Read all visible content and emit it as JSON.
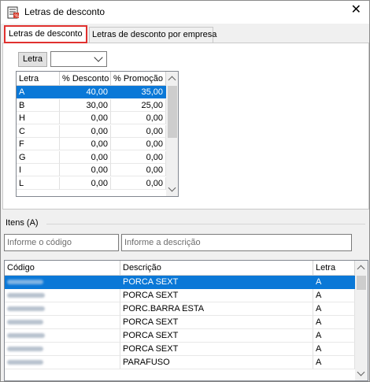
{
  "window": {
    "title": "Letras de desconto",
    "close_glyph": "✕"
  },
  "tabs": [
    {
      "label": "Letras de desconto",
      "active": true
    },
    {
      "label": "Letras de desconto por empresa",
      "active": false
    }
  ],
  "letra_filter": {
    "button_label": "Letra",
    "combo_value": ""
  },
  "letras_grid": {
    "columns": [
      "Letra",
      "% Desconto",
      "% Promoção"
    ],
    "rows": [
      {
        "letra": "A",
        "desconto": "40,00",
        "promocao": "35,00",
        "selected": true
      },
      {
        "letra": "B",
        "desconto": "30,00",
        "promocao": "25,00"
      },
      {
        "letra": "H",
        "desconto": "0,00",
        "promocao": "0,00"
      },
      {
        "letra": "C",
        "desconto": "0,00",
        "promocao": "0,00"
      },
      {
        "letra": "F",
        "desconto": "0,00",
        "promocao": "0,00"
      },
      {
        "letra": "G",
        "desconto": "0,00",
        "promocao": "0,00"
      },
      {
        "letra": "I",
        "desconto": "0,00",
        "promocao": "0,00"
      },
      {
        "letra": "L",
        "desconto": "0,00",
        "promocao": "0,00"
      }
    ]
  },
  "itens": {
    "label": "Itens (A)",
    "code_placeholder": "Informe o código",
    "desc_placeholder": "Informe a descrição",
    "columns": [
      "Código",
      "Descrição",
      "Letra"
    ],
    "rows": [
      {
        "descricao": "PORCA SEXT",
        "letra": "A",
        "selected": true
      },
      {
        "descricao": "PORCA SEXT",
        "letra": "A"
      },
      {
        "descricao": "PORC.BARRA ESTA",
        "letra": "A"
      },
      {
        "descricao": "PORCA SEXT",
        "letra": "A"
      },
      {
        "descricao": "PORCA SEXT",
        "letra": "A"
      },
      {
        "descricao": "PORCA SEXT",
        "letra": "A"
      },
      {
        "descricao": "PARAFUSO",
        "letra": "A"
      }
    ]
  },
  "colors": {
    "accent": "#0a78d7",
    "tab_highlight": "#e0312f"
  }
}
